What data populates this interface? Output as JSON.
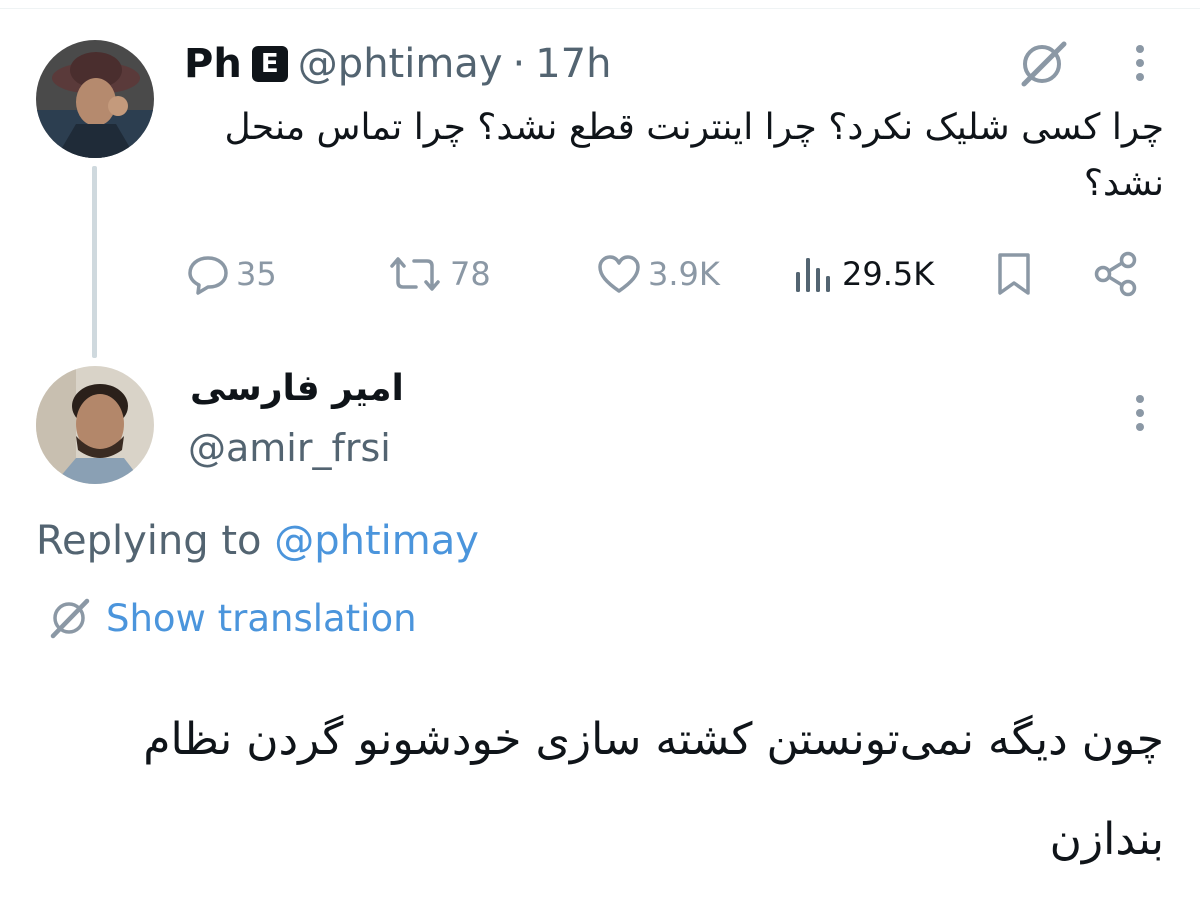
{
  "tweet": {
    "author_name": "Ph",
    "author_badge": "E",
    "author_handle": "@phtimay",
    "separator": "·",
    "time": "17h",
    "text": "چرا کسی شلیک نکرد؟ چرا اینترنت قطع نشد؟ چرا تماس منحل نشد؟",
    "stats": {
      "replies": "35",
      "reposts": "78",
      "likes": "3.9K",
      "views": "29.5K"
    }
  },
  "reply": {
    "author_name": "امیر فارسی",
    "author_handle": "@amir_frsi",
    "replying_prefix": "Replying to",
    "replying_mention": "@phtimay",
    "translate_label": "Show translation",
    "text": "چون دیگه نمی‌تونستن کشته سازی خودشونو گردن نظام بندازن"
  },
  "colors": {
    "text": "#0f1419",
    "secondary": "#536471",
    "link": "#4b95dc",
    "icon": "#8b98a5",
    "thread_line": "#cfd9de"
  },
  "icons": [
    "grok-icon",
    "more-icon",
    "reply-icon",
    "repost-icon",
    "like-icon",
    "views-icon",
    "bookmark-icon",
    "share-icon",
    "translate-icon"
  ]
}
